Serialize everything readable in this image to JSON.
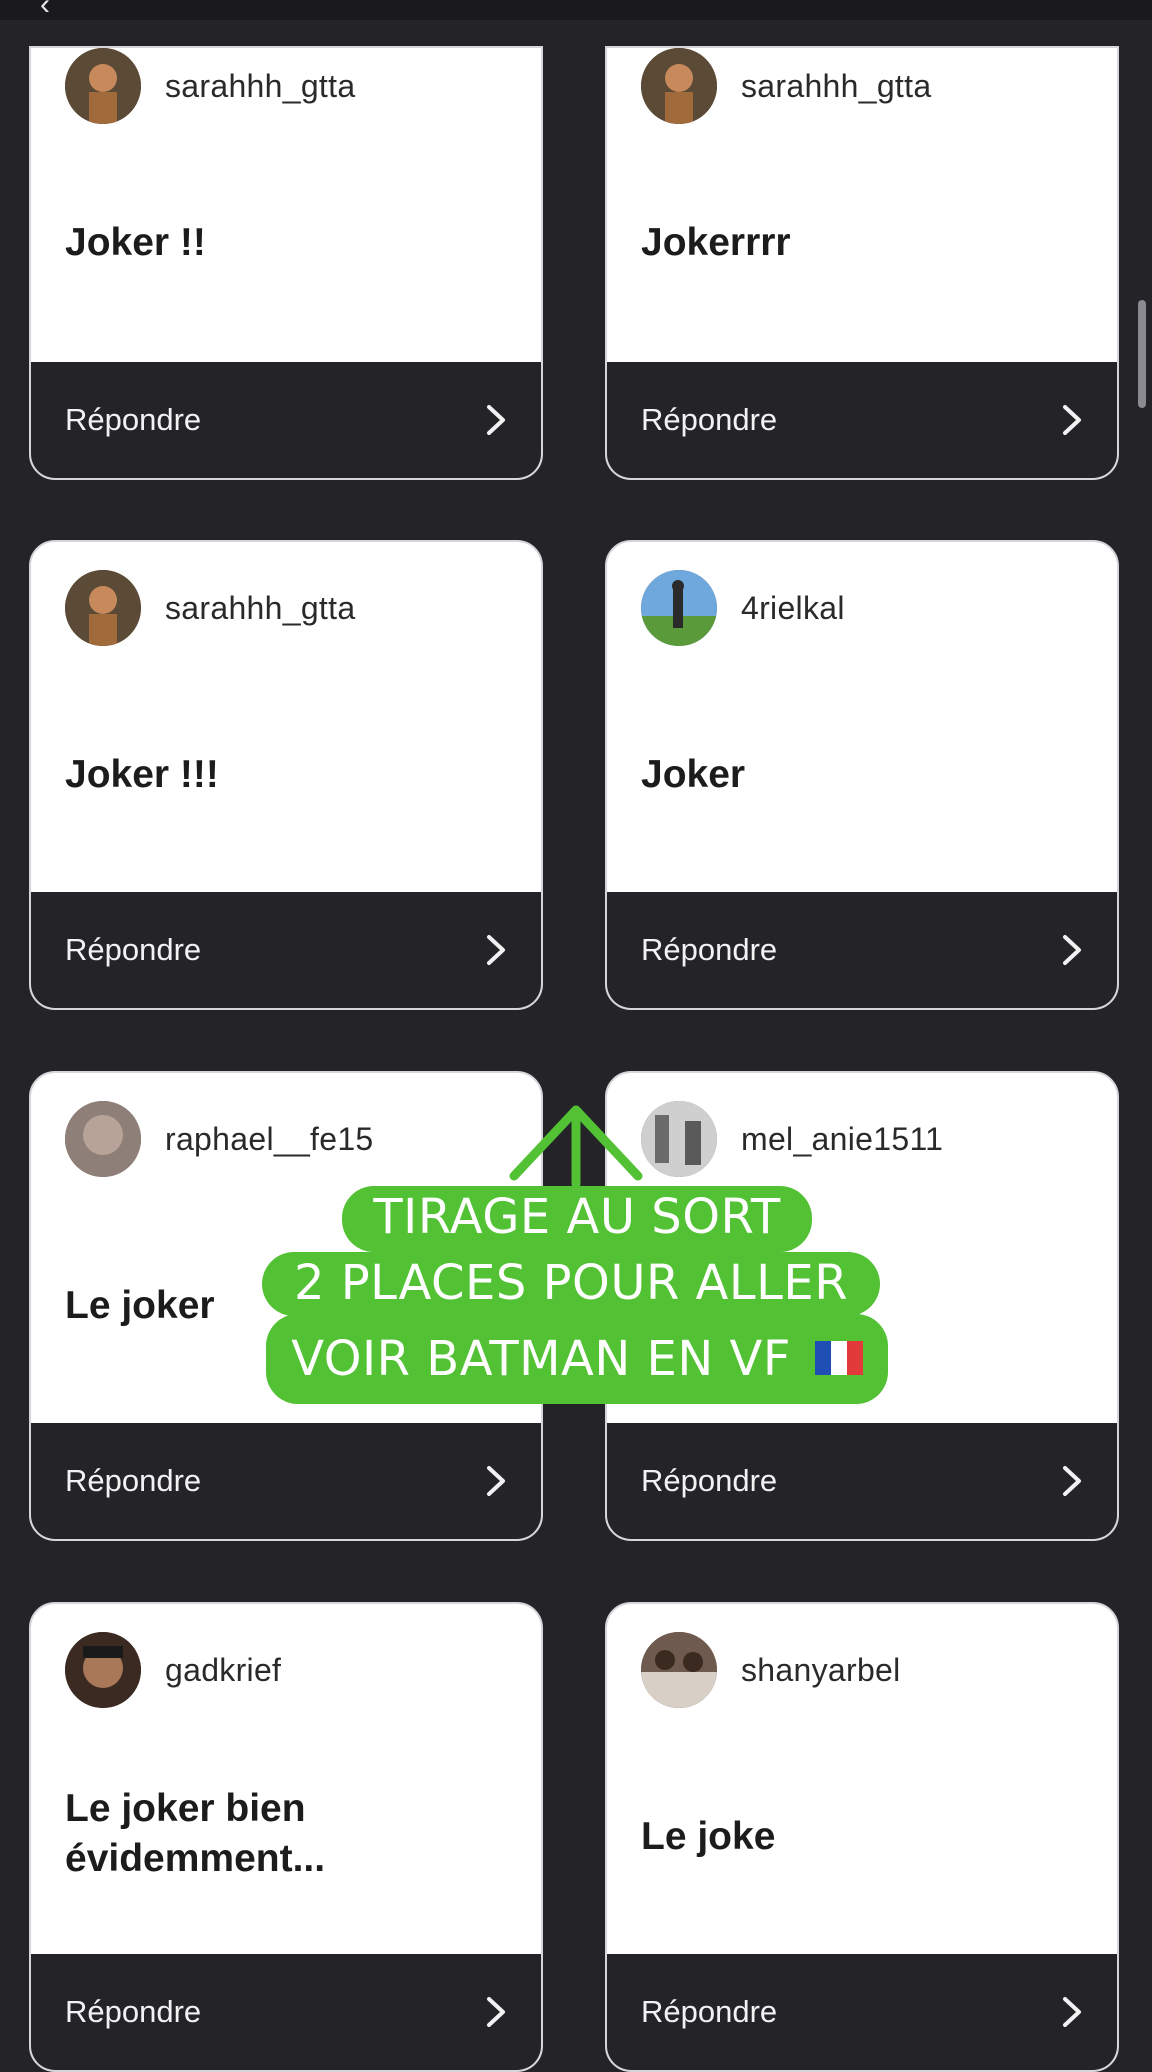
{
  "topbar": {
    "back_icon": "chevron-left-icon"
  },
  "reply_label": "Répondre",
  "cards": [
    {
      "username": "sarahhh_gtta",
      "message": "Joker !!",
      "avatar_color": "#7a5a3a"
    },
    {
      "username": "sarahhh_gtta",
      "message": "Jokerrrr",
      "avatar_color": "#7a5a3a"
    },
    {
      "username": "sarahhh_gtta",
      "message": "Joker !!!",
      "avatar_color": "#7a5a3a"
    },
    {
      "username": "4rielkal",
      "message": "Joker",
      "avatar_color": "#4a8fd0"
    },
    {
      "username": "raphael__fe15",
      "message": "Le joker",
      "avatar_color": "#8e7f78"
    },
    {
      "username": "mel_anie1511",
      "message": "",
      "avatar_color": "#9a9a9a"
    },
    {
      "username": "gadkrief",
      "message": "Le joker bien évidemment...",
      "avatar_color": "#3b2a22"
    },
    {
      "username": "shanyarbel",
      "message": "Le joke",
      "avatar_color": "#6e5a4e"
    }
  ],
  "overlay": {
    "line1": "TIRAGE AU SORT",
    "line2": "2 PLACES POUR ALLER",
    "line3": "VOIR BATMAN EN VF",
    "flag_icon": "france-flag-icon",
    "color": "#52c234"
  }
}
